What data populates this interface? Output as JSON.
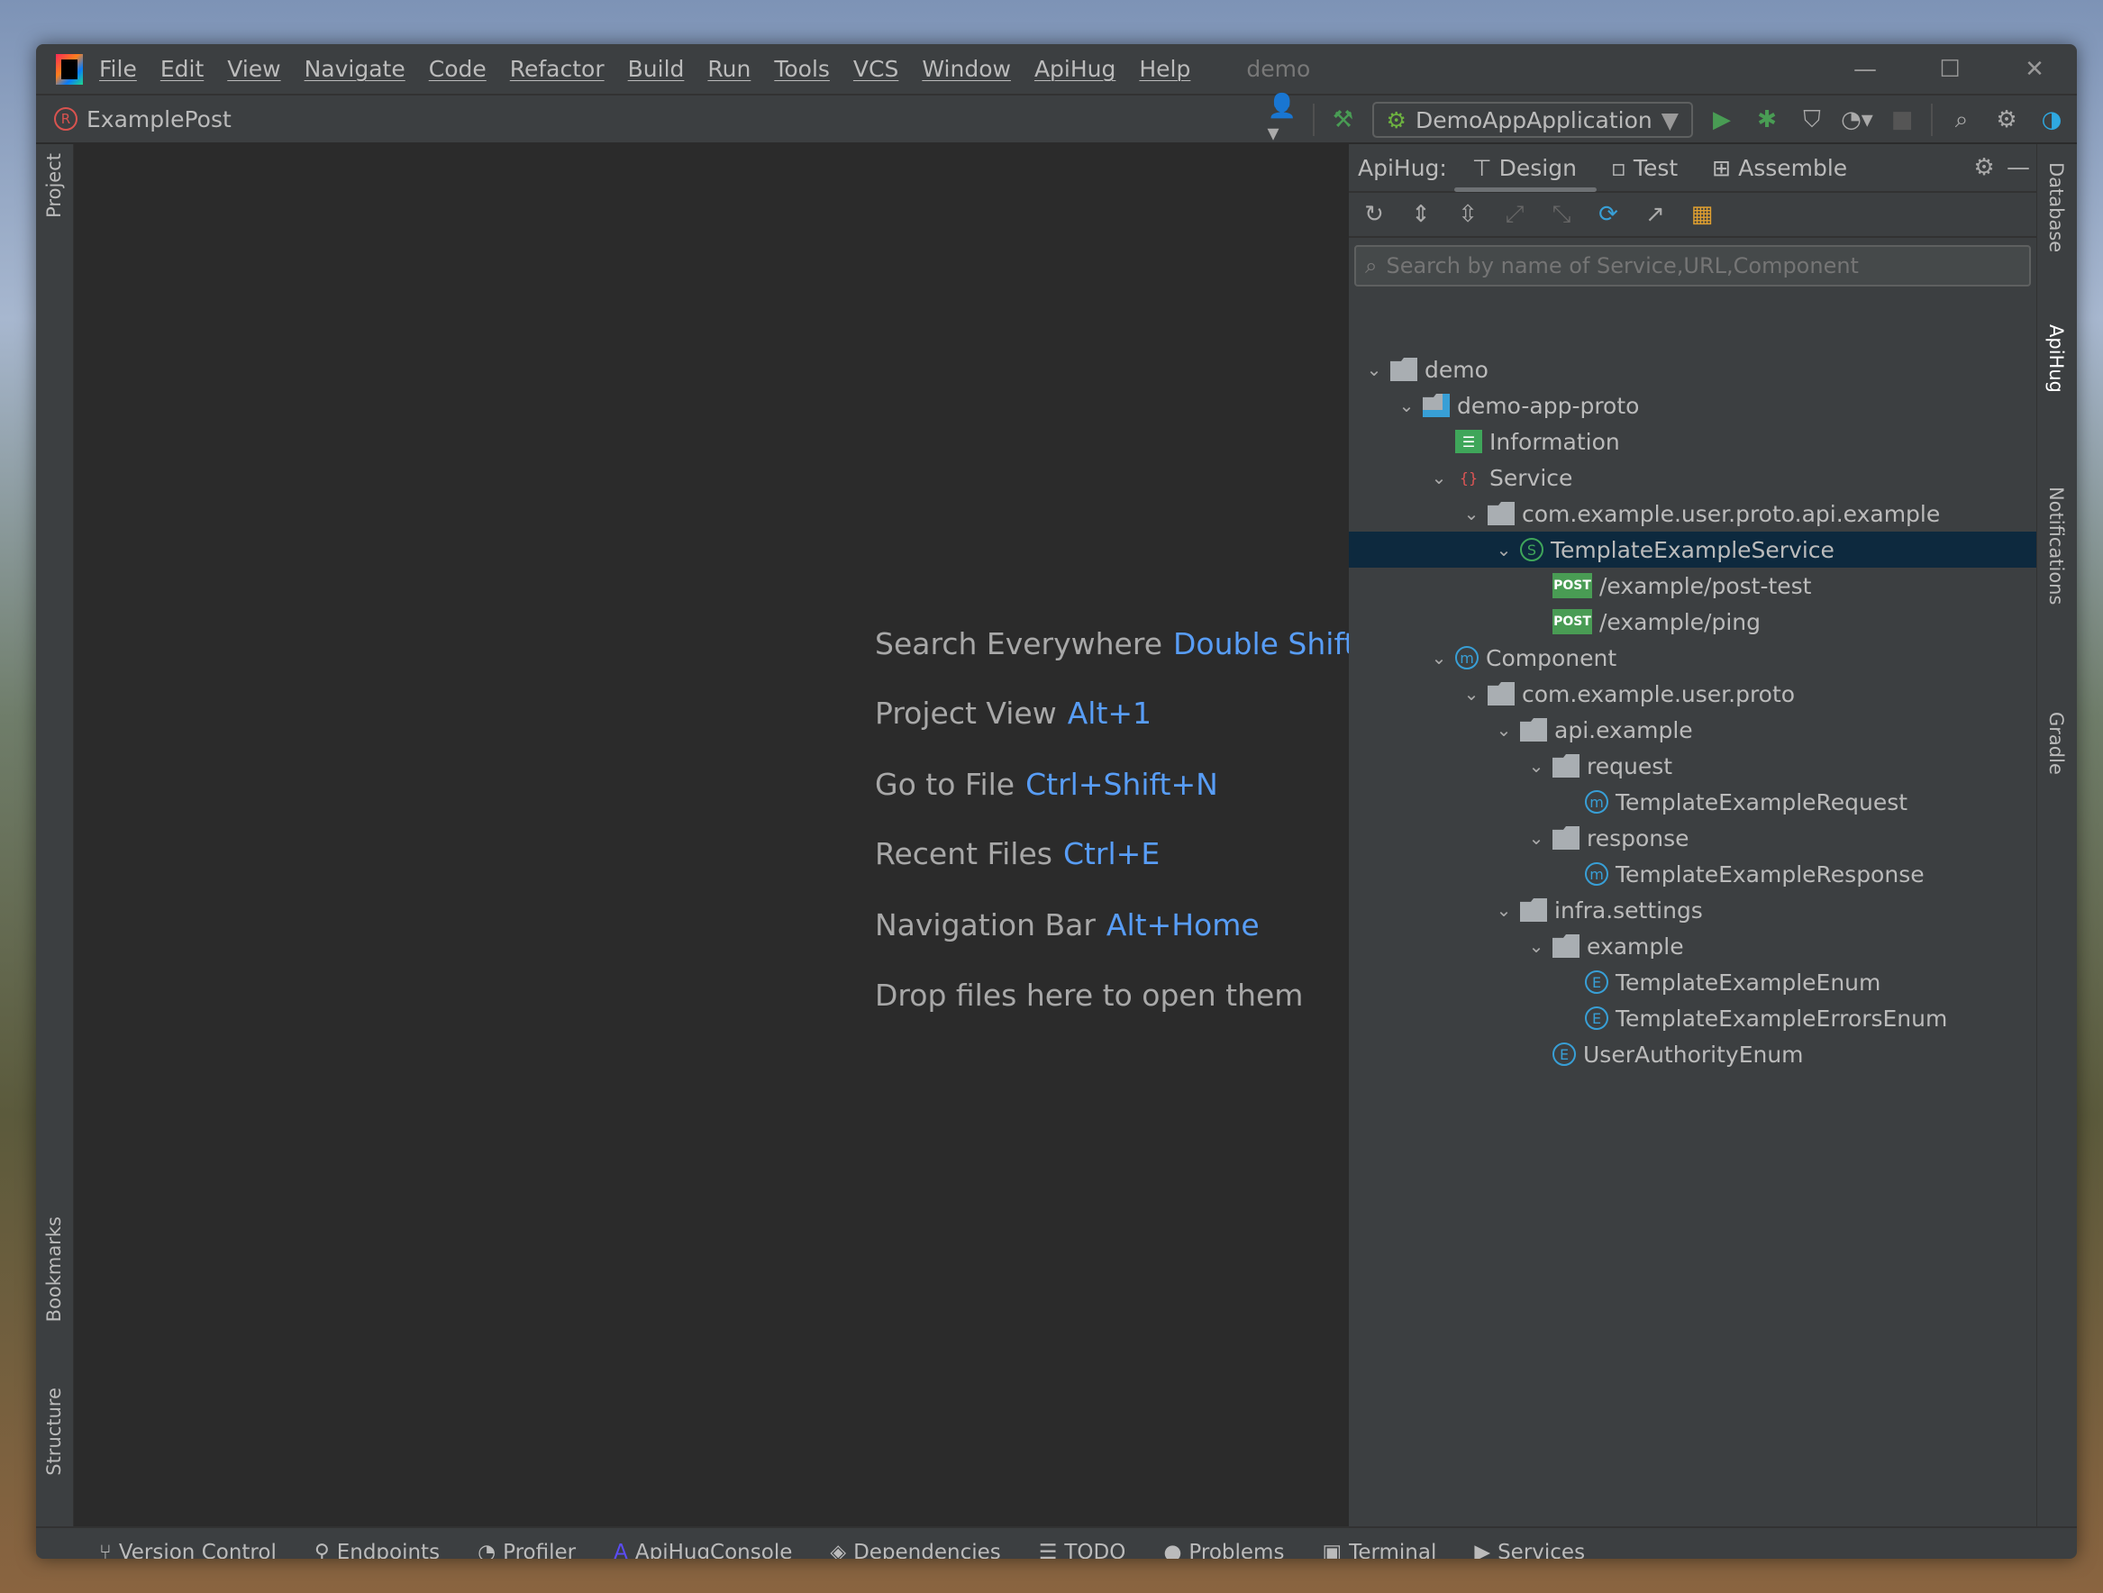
{
  "window": {
    "title": "demo",
    "menu": [
      "File",
      "Edit",
      "View",
      "Navigate",
      "Code",
      "Refactor",
      "Build",
      "Run",
      "Tools",
      "VCS",
      "Window",
      "ApiHug",
      "Help"
    ]
  },
  "toolbar": {
    "breadcrumb": "ExamplePost",
    "run_config": "DemoAppApplication"
  },
  "left_strip": {
    "project": "Project",
    "bookmarks": "Bookmarks",
    "structure": "Structure"
  },
  "right_strip": {
    "database": "Database",
    "apihug": "ApiHug",
    "notifications": "Notifications",
    "gradle": "Gradle"
  },
  "editor": {
    "hints": [
      {
        "label": "Search Everywhere",
        "key": "Double Shift"
      },
      {
        "label": "Project View",
        "key": "Alt+1"
      },
      {
        "label": "Go to File",
        "key": "Ctrl+Shift+N"
      },
      {
        "label": "Recent Files",
        "key": "Ctrl+E"
      },
      {
        "label": "Navigation Bar",
        "key": "Alt+Home"
      },
      {
        "label": "Drop files here to open them",
        "key": ""
      }
    ]
  },
  "panel": {
    "prefix": "ApiHug:",
    "tabs": [
      "Design",
      "Test",
      "Assemble"
    ],
    "active_tab": "Design",
    "search_placeholder": "Search by name of Service,URL,Component",
    "tree": [
      {
        "label": "demo",
        "level": 0,
        "expanded": true,
        "icon": "folder"
      },
      {
        "label": "demo-app-proto",
        "level": 1,
        "expanded": true,
        "icon": "module-folder"
      },
      {
        "label": "Information",
        "level": 2,
        "icon": "book"
      },
      {
        "label": "Service",
        "level": 2,
        "expanded": true,
        "icon": "service"
      },
      {
        "label": "com.example.user.proto.api.example",
        "level": 3,
        "expanded": true,
        "icon": "package"
      },
      {
        "label": "TemplateExampleService",
        "level": 4,
        "expanded": true,
        "icon": "S",
        "selected": true
      },
      {
        "label": "/example/post-test",
        "level": 5,
        "icon": "POST"
      },
      {
        "label": "/example/ping",
        "level": 5,
        "icon": "POST"
      },
      {
        "label": "Component",
        "level": 2,
        "expanded": true,
        "icon": "component"
      },
      {
        "label": "com.example.user.proto",
        "level": 3,
        "expanded": true,
        "icon": "package"
      },
      {
        "label": "api.example",
        "level": 4,
        "expanded": true,
        "icon": "package"
      },
      {
        "label": "request",
        "level": 5,
        "expanded": true,
        "icon": "package"
      },
      {
        "label": "TemplateExampleRequest",
        "level": 6,
        "icon": "m"
      },
      {
        "label": "response",
        "level": 5,
        "expanded": true,
        "icon": "package"
      },
      {
        "label": "TemplateExampleResponse",
        "level": 6,
        "icon": "m"
      },
      {
        "label": "infra.settings",
        "level": 4,
        "expanded": true,
        "icon": "package"
      },
      {
        "label": "example",
        "level": 5,
        "expanded": true,
        "icon": "package"
      },
      {
        "label": "TemplateExampleEnum",
        "level": 6,
        "icon": "E"
      },
      {
        "label": "TemplateExampleErrorsEnum",
        "level": 6,
        "icon": "E"
      },
      {
        "label": "UserAuthorityEnum",
        "level": 5,
        "icon": "E"
      }
    ]
  },
  "bottom_tools": [
    "Version Control",
    "Endpoints",
    "Profiler",
    "ApiHugConsole",
    "Dependencies",
    "TODO",
    "Problems",
    "Terminal",
    "Services"
  ],
  "colors": {
    "accent": "#589df6",
    "selection": "#0d293e",
    "post": "#499c54",
    "apihug": "#5b4cf5"
  }
}
